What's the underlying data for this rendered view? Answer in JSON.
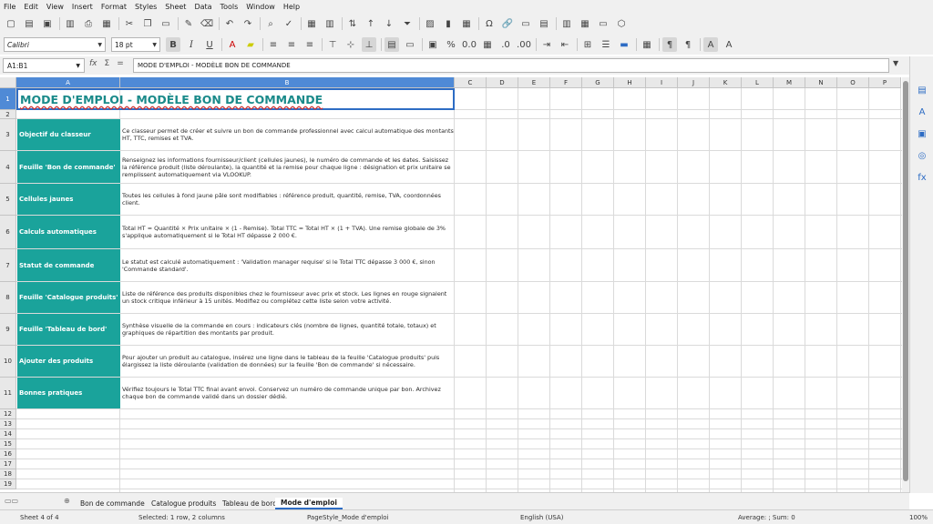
{
  "menu": [
    "File",
    "Edit",
    "View",
    "Insert",
    "Format",
    "Styles",
    "Sheet",
    "Data",
    "Tools",
    "Window",
    "Help"
  ],
  "toolbar": {
    "font_name": "Calibri",
    "font_size": "18 pt"
  },
  "formula_bar": {
    "cell_ref": "A1:B1",
    "content": "MODE D'EMPLOI - MODÈLE BON DE COMMANDE"
  },
  "columns": [
    "A",
    "B",
    "C",
    "D",
    "E",
    "F",
    "G",
    "H",
    "I",
    "J",
    "K",
    "L",
    "M",
    "N",
    "O",
    "P"
  ],
  "rows": [
    "1",
    "2",
    "3",
    "4",
    "5",
    "6",
    "7",
    "8",
    "9",
    "10",
    "11",
    "12",
    "13",
    "14",
    "15",
    "16",
    "17",
    "18",
    "19"
  ],
  "sheet": {
    "title": "MODE D'EMPLOI - MODÈLE BON DE COMMANDE",
    "entries": [
      {
        "label": "Objectif du classeur",
        "text": "Ce classeur permet de créer et suivre un bon de commande professionnel avec calcul automatique des montants HT, TTC, remises et TVA."
      },
      {
        "label": "Feuille 'Bon de commande'",
        "text": "Renseignez les informations fournisseur/client (cellules jaunes), le numéro de commande et les dates. Saisissez la référence produit (liste déroulante), la quantité et la remise pour chaque ligne : désignation et prix unitaire se remplissent automatiquement via VLOOKUP."
      },
      {
        "label": "Cellules jaunes",
        "text": "Toutes les cellules à fond jaune pâle sont modifiables : référence produit, quantité, remise, TVA, coordonnées client."
      },
      {
        "label": "Calculs automatiques",
        "text": "Total HT = Quantité × Prix unitaire × (1 - Remise). Total TTC = Total HT × (1 + TVA). Une remise globale de 3% s'applique automatiquement si le Total HT dépasse 2 000 €."
      },
      {
        "label": "Statut de commande",
        "text": "Le statut est calculé automatiquement : 'Validation manager requise' si le Total TTC dépasse 3 000 €, sinon 'Commande standard'."
      },
      {
        "label": "Feuille 'Catalogue produits'",
        "text": "Liste de référence des produits disponibles chez le fournisseur avec prix et stock. Les lignes en rouge signalent un stock critique inférieur à 15 unités. Modifiez ou complétez cette liste selon votre activité."
      },
      {
        "label": "Feuille 'Tableau de bord'",
        "text": "Synthèse visuelle de la commande en cours : indicateurs clés (nombre de lignes, quantité totale, totaux) et graphiques de répartition des montants par produit."
      },
      {
        "label": "Ajouter des produits",
        "text": "Pour ajouter un produit au catalogue, insérez une ligne dans le tableau de la feuille 'Catalogue produits' puis élargissez la liste déroulante (validation de données) sur la feuille 'Bon de commande' si nécessaire."
      },
      {
        "label": "Bonnes pratiques",
        "text": "Vérifiez toujours le Total TTC final avant envoi. Conservez un numéro de commande unique par bon. Archivez chaque bon de commande validé dans un dossier dédié."
      }
    ]
  },
  "tabs": [
    "Bon de commande",
    "Catalogue produits",
    "Tableau de bord",
    "Mode d'emploi"
  ],
  "status": {
    "sheet": "Sheet 4 of 4",
    "selection": "Selected: 1 row, 2 columns",
    "page_style": "PageStyle_Mode d'emploi",
    "language": "English (USA)",
    "sum": "Average: ; Sum: 0",
    "zoom": "100%"
  }
}
